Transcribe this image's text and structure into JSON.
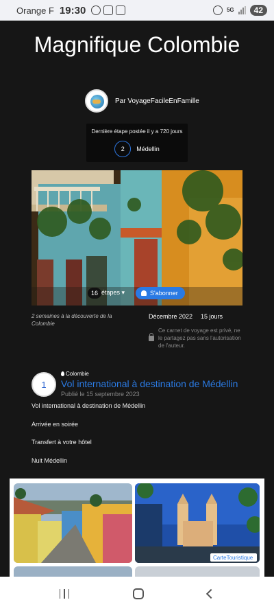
{
  "status_bar": {
    "carrier": "Orange F",
    "time": "19:30",
    "network": "5G",
    "battery": "42"
  },
  "trip": {
    "title": "Magnifique Colombie",
    "author": "Par VoyageFacileEnFamille",
    "last_step_label": "Dernière étape postée il y a 720 jours",
    "last_step_number": "2",
    "last_step_place": "Médellin",
    "steps_count": "16",
    "steps_label": "étapes",
    "subscribe_label": "S'abonner",
    "description": "2 semaines à la découverte de la Colombie",
    "date": "Décembre 2022",
    "duration": "15 jours",
    "private_notice": "Ce carnet de voyage est privé, ne le partagez pas sans l'autorisation de l'auteur."
  },
  "step": {
    "number": "1",
    "location": "Colombie",
    "title": "Vol international à destination de Médellin",
    "published": "Publié le 15 septembre 2023",
    "paragraphs": [
      "Vol international à destination de Médellin",
      "Arrivée en soirée",
      "Transfert à votre hôtel",
      "Nuit Médellin"
    ]
  },
  "gallery": {
    "watermark": "CarteTouristique"
  },
  "icons": [
    "whatsapp-icon",
    "scan-icon",
    "gmail-icon",
    "hotspot-icon",
    "signal-icon",
    "pin-icon",
    "bell-icon",
    "lock-icon",
    "recent-apps-icon",
    "home-icon",
    "back-icon"
  ]
}
